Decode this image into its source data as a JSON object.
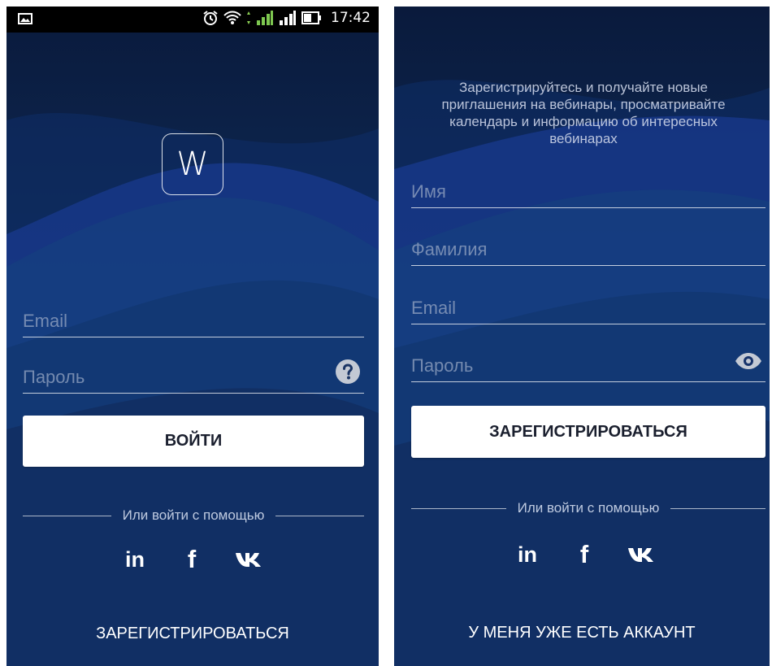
{
  "status_bar": {
    "time": "17:42"
  },
  "login": {
    "logo_letter": "W",
    "email_placeholder": "Email",
    "password_placeholder": "Пароль",
    "login_button": "ВОЙТИ",
    "divider_text": "Или войти с помощью",
    "social": [
      "in",
      "f",
      "vk"
    ],
    "register_link": "ЗАРЕГИСТРИРОВАТЬСЯ"
  },
  "register": {
    "intro_text": "Зарегистрируйтесь и получайте новые приглашения на вебинары, просматривайте календарь и информацию об интересных вебинарах",
    "first_name_placeholder": "Имя",
    "last_name_placeholder": "Фамилия",
    "email_placeholder": "Email",
    "password_placeholder": "Пароль",
    "register_button": "ЗАРЕГИСТРИРОВАТЬСЯ",
    "divider_text": "Или войти с помощью",
    "social": [
      "in",
      "f",
      "vk"
    ],
    "have_account_link": "У МЕНЯ УЖЕ ЕСТЬ АККАУНТ"
  },
  "icons": {
    "help": "question-circle-icon",
    "eye": "eye-icon",
    "linkedin": "linkedin-icon",
    "facebook": "facebook-icon",
    "vk": "vk-icon"
  },
  "colors": {
    "background_top": "#0a1a3c",
    "background_bottom": "#13356b",
    "button_bg": "#ffffff",
    "button_text": "#1a1f2e"
  }
}
